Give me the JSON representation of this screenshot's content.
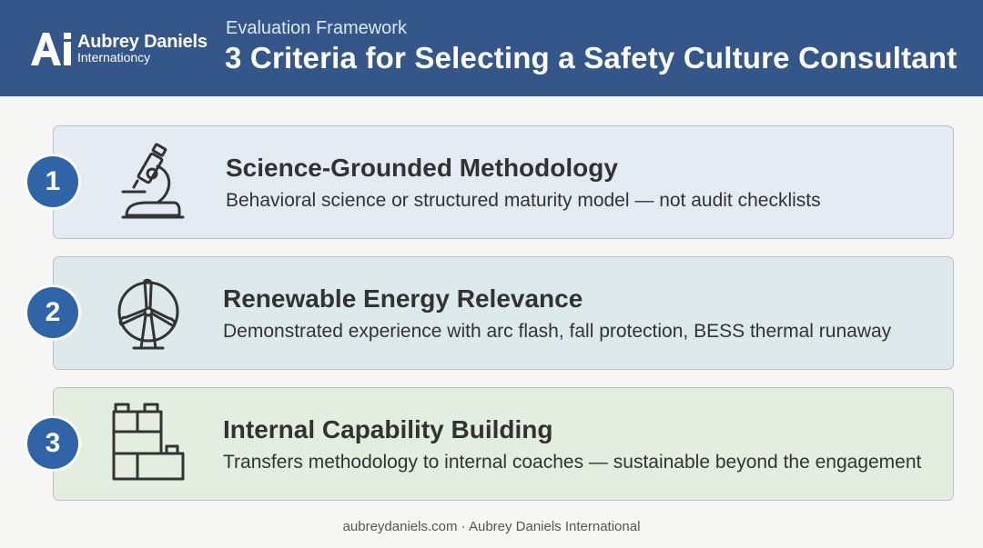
{
  "header": {
    "logo": {
      "mark_text": "Ai",
      "name": "Aubrey Daniels",
      "subname": "Internationcy"
    },
    "eyebrow": "Evaluation Framework",
    "title": "3 Criteria for Selecting a Safety Culture Consultant",
    "background_color": "#355689"
  },
  "criteria": [
    {
      "number": "1",
      "icon": "microscope-icon",
      "title": "Science-Grounded Methodology",
      "description": "Behavioral science or structured maturity model — not audit checklists",
      "card_color": "#e4ebf3"
    },
    {
      "number": "2",
      "icon": "wind-turbine-icon",
      "title": "Renewable Energy Relevance",
      "description": "Demonstrated experience with arc flash, fall protection, BESS thermal runaway",
      "card_color": "#dde9ea"
    },
    {
      "number": "3",
      "icon": "building-blocks-icon",
      "title": "Internal Capability Building",
      "description": "Transfers methodology to internal coaches — sustainable beyond the engagement",
      "card_color": "#e4eee0"
    }
  ],
  "badge_color": "#2f65a8",
  "footer": {
    "text": "aubreydaniels.com · Aubrey Daniels International"
  }
}
